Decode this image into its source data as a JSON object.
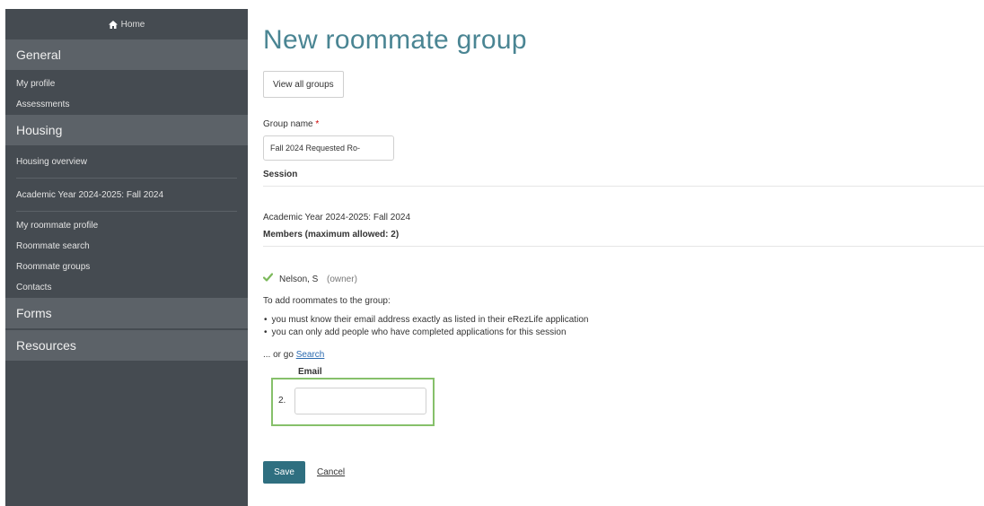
{
  "sidebar": {
    "home": "Home",
    "general": {
      "heading": "General",
      "items": [
        "My profile",
        "Assessments"
      ]
    },
    "housing": {
      "heading": "Housing",
      "overview": "Housing overview",
      "session": "Academic Year 2024-2025: Fall 2024",
      "items": [
        "My roommate profile",
        "Roommate search",
        "Roommate groups",
        "Contacts"
      ]
    },
    "forms": "Forms",
    "resources": "Resources"
  },
  "main": {
    "title": "New roommate group",
    "view_all": "View all groups",
    "group_name_label": "Group name",
    "required_mark": "*",
    "group_name_value": "Fall 2024 Requested Ro-",
    "session_label": "Session",
    "session_value": "Academic Year 2024-2025: Fall 2024",
    "members_label": "Members (maximum allowed: 2)",
    "member": {
      "name": "Nelson, S",
      "role": "(owner)"
    },
    "instructions": "To add roommates to the group:",
    "bullets": [
      "you must know their email address exactly as listed in their eRezLife application",
      "you can only add people who have completed applications for this session"
    ],
    "or_go": "... or go",
    "search_link": "Search",
    "email_label": "Email",
    "email_row_number": "2.",
    "save": "Save",
    "cancel": "Cancel"
  },
  "colors": {
    "sidebar_bg": "#454b51",
    "sidebar_heading_bg": "#5c6268",
    "title": "#4a8593",
    "save_button": "#2f6f80",
    "highlight_border": "#86c06a",
    "check": "#7cb95b"
  }
}
